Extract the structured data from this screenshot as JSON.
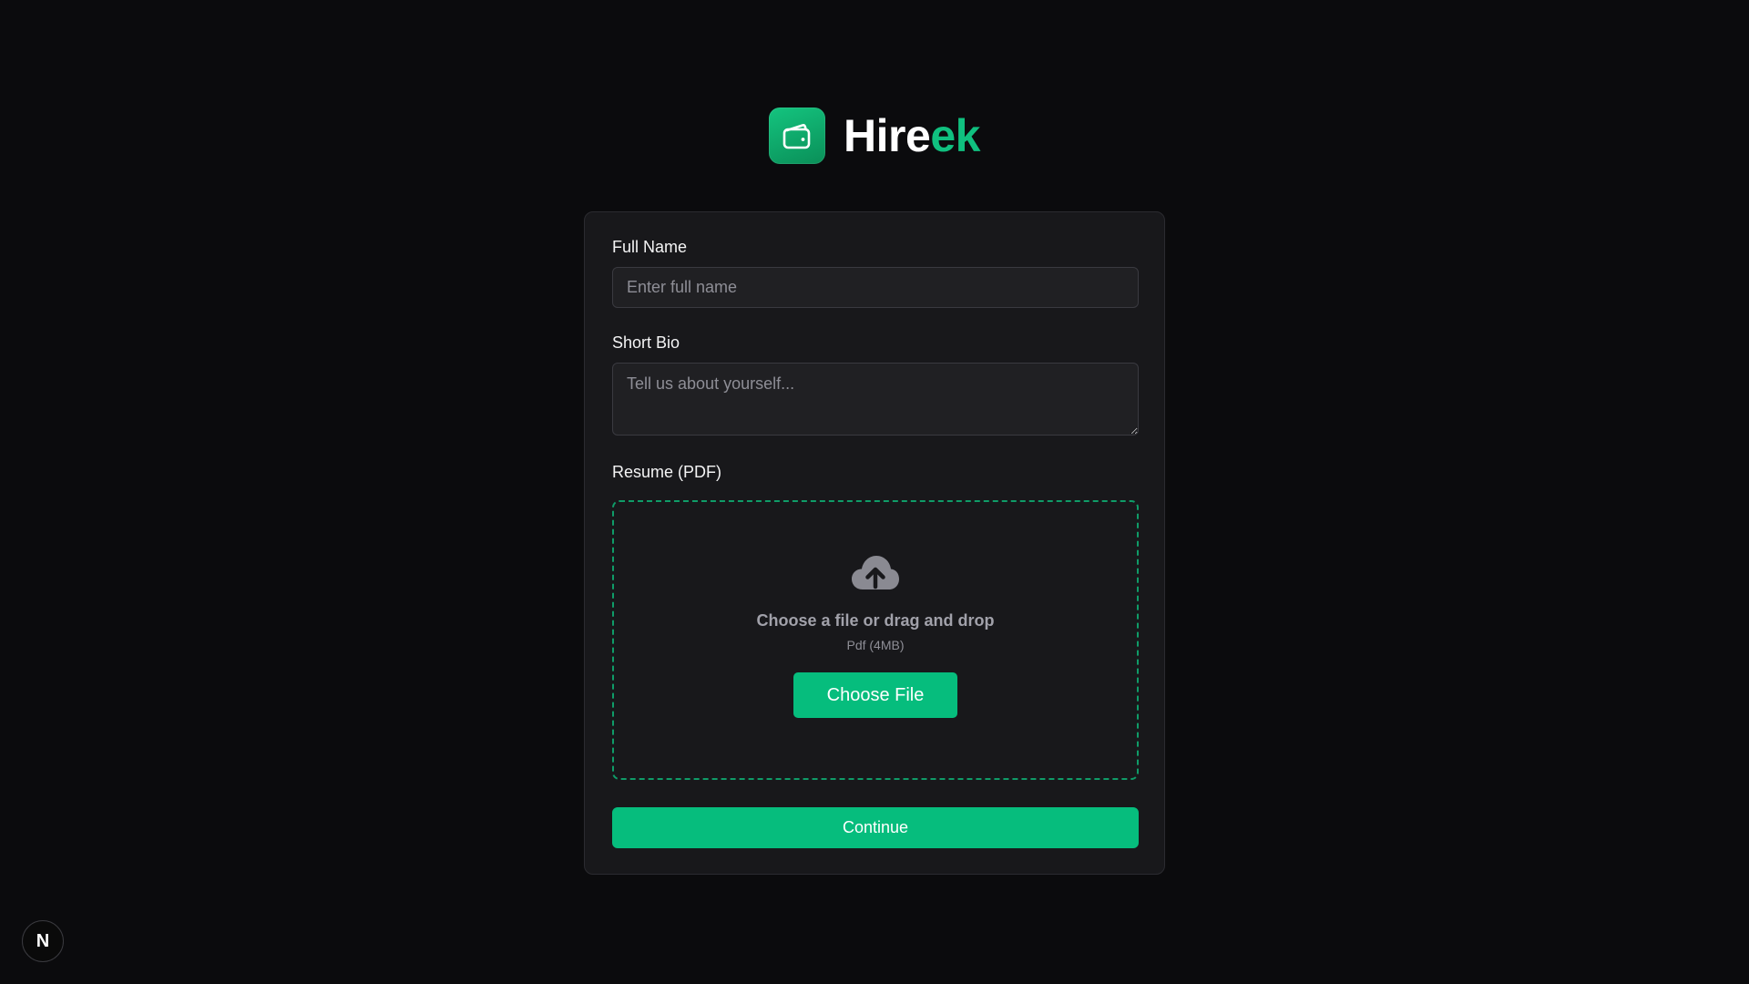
{
  "brand": {
    "name_part1": "Hire",
    "name_part2": "ek",
    "logo_icon": "wallet-icon",
    "accent_color": "#10c07f"
  },
  "form": {
    "full_name": {
      "label": "Full Name",
      "placeholder": "Enter full name",
      "value": ""
    },
    "short_bio": {
      "label": "Short Bio",
      "placeholder": "Tell us about yourself...",
      "value": ""
    },
    "resume": {
      "label": "Resume (PDF)",
      "upload_icon": "cloud-upload-icon",
      "drop_title": "Choose a file or drag and drop",
      "drop_subtitle": "Pdf (4MB)",
      "choose_button": "Choose File"
    },
    "continue_button": "Continue"
  },
  "dev_badge": {
    "label": "N",
    "icon": "nextjs-icon"
  }
}
